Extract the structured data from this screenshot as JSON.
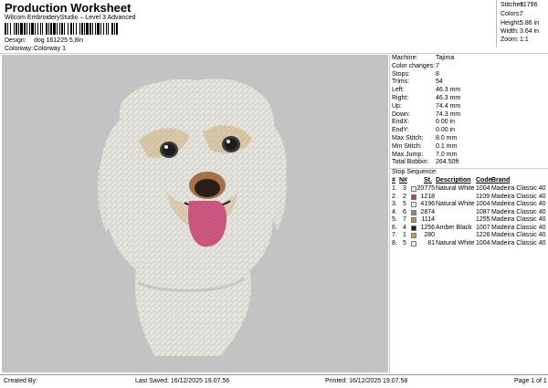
{
  "header": {
    "title": "Production Worksheet",
    "subtitle": "Wilcom EmbroideryStudio – Level 3 Advanced",
    "design_label": "Design:",
    "design_value": "dog 161225 5,8in",
    "colorway_label": "Colorway:",
    "colorway_value": "Colorway 1"
  },
  "stats": {
    "stitches_label": "Stitches:",
    "stitches_value": "31796",
    "colors_label": "Colors:",
    "colors_value": "7",
    "height_label": "Height:",
    "height_value": "5.86 in",
    "width_label": "Width:",
    "width_value": "3.64 in",
    "zoom_label": "Zoom:",
    "zoom_value": "1:1"
  },
  "machine_info": [
    {
      "label": "Machine:",
      "value": "Tajima"
    },
    {
      "label": "Color changes:",
      "value": "7"
    },
    {
      "label": "Stops:",
      "value": "8"
    },
    {
      "label": "Trims:",
      "value": "54"
    },
    {
      "label": "Left:",
      "value": "46.3 mm"
    },
    {
      "label": "Right:",
      "value": "46.3 mm"
    },
    {
      "label": "Up:",
      "value": "74.4 mm"
    },
    {
      "label": "Down:",
      "value": "74.3 mm"
    },
    {
      "label": "EndX:",
      "value": "0.00 in"
    },
    {
      "label": "EndY:",
      "value": "0.00 in"
    },
    {
      "label": "Max Stitch:",
      "value": "8.0 mm"
    },
    {
      "label": "Min Stitch:",
      "value": "0.1 mm"
    },
    {
      "label": "Max Jump:",
      "value": "7.0 mm"
    },
    {
      "label": "Total Bobbin:",
      "value": "264.50ft"
    }
  ],
  "stop_sequence": {
    "title": "Stop Sequence:",
    "headers": {
      "num": "#",
      "n": "N#",
      "st": "St.",
      "desc": "Description",
      "code": "Code",
      "brand": "Brand"
    },
    "rows": [
      {
        "num": "1.",
        "n": "3",
        "color": "#ececec",
        "st": "20775",
        "desc": "Natural White",
        "code": "1004",
        "brand": "Madeira Classic 40"
      },
      {
        "num": "2.",
        "n": "2",
        "color": "#c2356b",
        "st": "1218",
        "desc": "",
        "code": "1109",
        "brand": "Madeira Classic 40"
      },
      {
        "num": "3.",
        "n": "5",
        "color": "#ececec",
        "st": "4196",
        "desc": "Natural White",
        "code": "1004",
        "brand": "Madeira Classic 40"
      },
      {
        "num": "4.",
        "n": "6",
        "color": "#8a8a8a",
        "st": "2874",
        "desc": "",
        "code": "1087",
        "brand": "Madeira Classic 40"
      },
      {
        "num": "5.",
        "n": "7",
        "color": "#c08a5a",
        "st": "1114",
        "desc": "",
        "code": "1255",
        "brand": "Madeira Classic 40"
      },
      {
        "num": "6.",
        "n": "4",
        "color": "#1a1a1a",
        "st": "1256",
        "desc": "Amber Black",
        "code": "1007",
        "brand": "Madeira Classic 40"
      },
      {
        "num": "7.",
        "n": "1",
        "color": "#c9985f",
        "st": "280",
        "desc": "",
        "code": "1226",
        "brand": "Madeira Classic 40"
      },
      {
        "num": "8.",
        "n": "5",
        "color": "#ececec",
        "st": "81",
        "desc": "Natural White",
        "code": "1004",
        "brand": "Madeira Classic 40"
      }
    ]
  },
  "footer": {
    "created_by": "Created By:",
    "last_saved": "Last Saved: 16/12/2025 19.07.56",
    "printed": "Printed: 16/12/2025 19.07.58",
    "page": "Page 1 of 1"
  }
}
